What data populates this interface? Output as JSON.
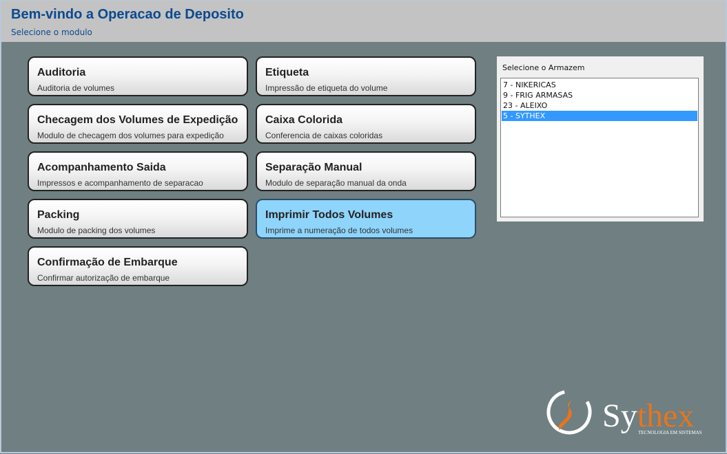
{
  "header": {
    "title": "Bem-vindo a Operacao de Deposito",
    "subtitle": "Selecione o modulo"
  },
  "modules": [
    {
      "title": "Auditoria",
      "description": "Auditoria de volumes"
    },
    {
      "title": "Etiqueta",
      "description": "Impressão de etiqueta do volume"
    },
    {
      "title": "Checagem dos Volumes de Expedição",
      "description": "Modulo de checagem dos volumes para expedição"
    },
    {
      "title": "Caixa Colorida",
      "description": "Conferencia de caixas coloridas"
    },
    {
      "title": "Acompanhamento Saida",
      "description": "Impressos e acompanhamento de separacao"
    },
    {
      "title": "Separação Manual",
      "description": "Modulo de separação manual da onda"
    },
    {
      "title": "Packing",
      "description": "Modulo de packing dos volumes"
    },
    {
      "title": "Imprimir Todos Volumes",
      "description": "Imprime a numeração de todos volumes",
      "active": true
    },
    {
      "title": "Confirmação de Embarque",
      "description": "Confirmar autorização de embarque"
    }
  ],
  "warehouse": {
    "label": "Selecione o Armazem",
    "options": [
      "7 - NIKERICAS",
      "9 - FRIG ARMASAS",
      "23 - ALEIXO",
      "5 - SYTHEX"
    ],
    "selected": "5 - SYTHEX"
  },
  "logo": {
    "brand_prefix": "Sy",
    "brand_suffix": "thex",
    "tagline": "TECNOLOGIA EM SISTEMAS",
    "colors": {
      "primary": "#ffffff",
      "accent": "#e8751a"
    }
  },
  "colors": {
    "background": "#6f7f82",
    "header": "#c3c3c3",
    "title": "#0b4a8f",
    "active_tile": "#8fd4fb",
    "selection": "#3399ff"
  }
}
